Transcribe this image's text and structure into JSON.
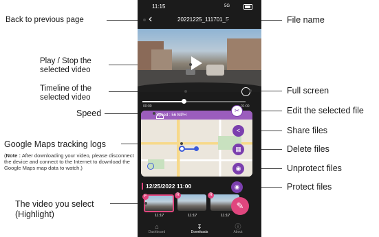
{
  "phone": {
    "status": {
      "time": "11:15",
      "signal": "5G"
    },
    "file_name": "20221225_111701_F",
    "speed_text": "Speed : 56 MPH",
    "timeline": {
      "start": "00:00",
      "end": "01:00",
      "progress": 0.4
    },
    "date_header": "12/25/2022 11:00",
    "thumbnails": [
      {
        "badge": "F",
        "caption": "11:17",
        "selected": true
      },
      {
        "badge": "R",
        "caption": "11:17",
        "selected": false
      },
      {
        "badge": "R",
        "caption": "11:17",
        "selected": false
      }
    ],
    "nav": [
      "Dashboard",
      "Downloads",
      "About"
    ],
    "nav_active": "Downloads"
  },
  "annotations": {
    "back": "Back to previous page",
    "play_1": "Play / Stop the",
    "play_2": "selected video",
    "timeline_1": "Timeline of the",
    "timeline_2": "selected video",
    "speed": "Speed",
    "gmaps": "Google Maps tracking logs",
    "note_bold": "Note :",
    "note_text": " After downloading your video, please disconnect the device and connect to the Internet to download the Google Maps map data to watch.)",
    "selected_1": "The video you select",
    "selected_2": "(Highlight)",
    "file_name": "File name",
    "full_screen": "Full screen",
    "edit": "Edit the selected file",
    "share": "Share files",
    "delete": "Delete files",
    "unprotect": "Unprotect files",
    "protect": "Protect files"
  },
  "colors": {
    "accent": "#7b3fae",
    "highlight": "#e0467e"
  }
}
